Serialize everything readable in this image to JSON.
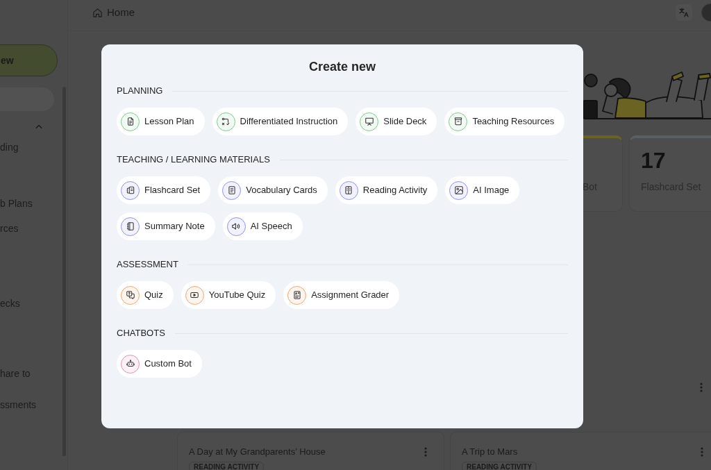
{
  "header": {
    "title": "Home"
  },
  "sidebar": {
    "new_button": "ew",
    "items": [
      {
        "label": "ding"
      },
      {
        "label": "b Plans"
      },
      {
        "label": "rces"
      },
      {
        "label": "ecks"
      },
      {
        "label": "hare to"
      },
      {
        "label": "ssments"
      }
    ]
  },
  "stats": [
    {
      "label": "Bot",
      "color": "#6b6322"
    },
    {
      "value": "17",
      "label": "Flashcard Set",
      "color": "#586063"
    }
  ],
  "recent": [
    {
      "title": "A Day at My Grandparents’ House",
      "tag": "READING ACTIVITY"
    },
    {
      "title": "A Trip to Mars",
      "tag": "READING ACTIVITY"
    }
  ],
  "modal": {
    "title": "Create new",
    "sections": [
      {
        "heading": "PLANNING",
        "color": "#7fc98f",
        "items": [
          {
            "label": "Lesson Plan"
          },
          {
            "label": "Differentiated Instruction"
          },
          {
            "label": "Slide Deck"
          },
          {
            "label": "Teaching Resources"
          }
        ]
      },
      {
        "heading": "TEACHING / LEARNING MATERIALS",
        "color": "#8d8ff0",
        "items": [
          {
            "label": "Flashcard Set"
          },
          {
            "label": "Vocabulary Cards"
          },
          {
            "label": "Reading Activity"
          },
          {
            "label": "AI Image"
          },
          {
            "label": "Summary Note"
          },
          {
            "label": "AI Speech"
          }
        ]
      },
      {
        "heading": "ASSESSMENT",
        "color": "#f0a46e",
        "items": [
          {
            "label": "Quiz"
          },
          {
            "label": "YouTube Quiz"
          },
          {
            "label": "Assignment Grader"
          }
        ]
      },
      {
        "heading": "CHATBOTS",
        "color": "#e68bb8",
        "items": [
          {
            "label": "Custom Bot"
          }
        ]
      }
    ]
  }
}
